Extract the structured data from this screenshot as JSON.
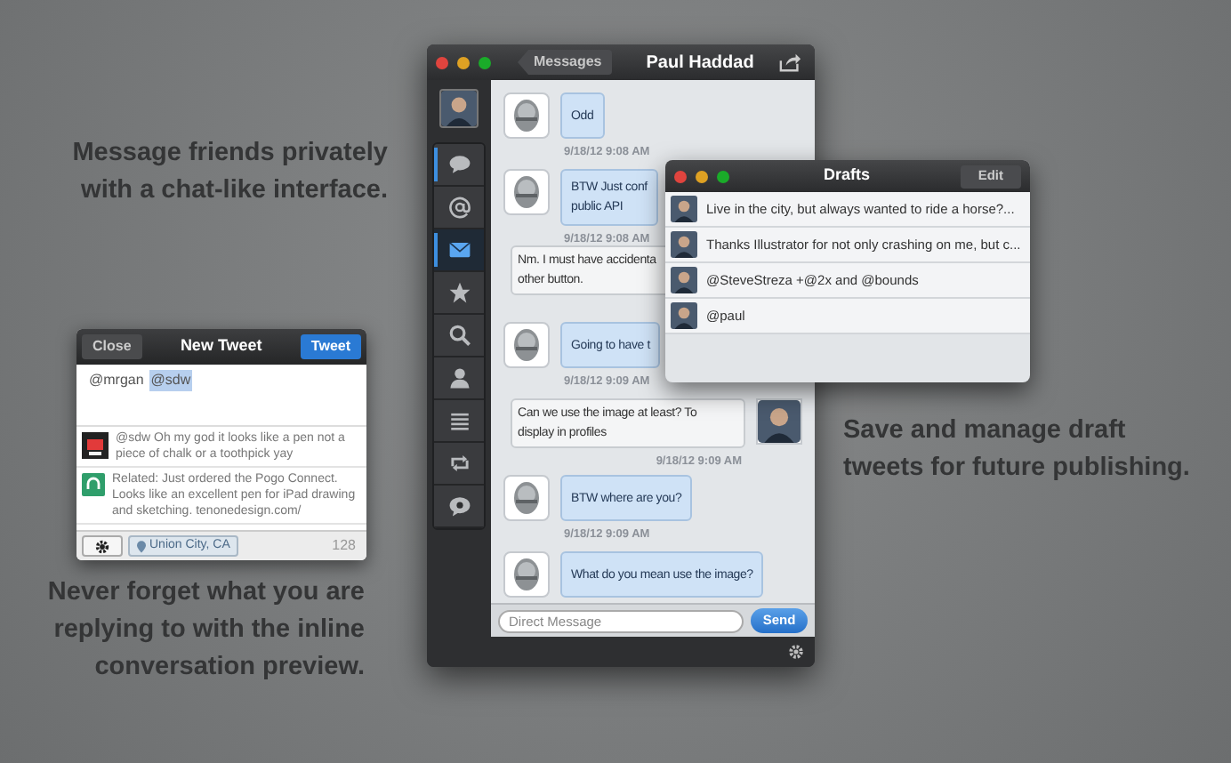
{
  "captions": [
    {
      "kind": "right",
      "lines": [
        "Message friends privately",
        "with a chat-like interface."
      ]
    },
    {
      "kind": "right",
      "lines": [
        "Never forget what you are",
        "replying to with the inline",
        "conversation preview."
      ]
    },
    {
      "kind": "left",
      "lines": [
        "Save and manage draft",
        "tweets for future publishing."
      ]
    }
  ],
  "new_tweet": {
    "close": "Close",
    "title": "New Tweet",
    "tweet": "Tweet",
    "mentions": [
      {
        "text": "@mrgan",
        "selected": false
      },
      {
        "text": "@sdw",
        "selected": true
      }
    ],
    "previews": [
      {
        "kind": "avatar",
        "lines": [
          "@sdw Oh my god it looks like a pen not a",
          "piece of chalk or a toothpick yay"
        ]
      },
      {
        "kind": "logo",
        "lines": [
          "Related: Just ordered the Pogo Connect.",
          "Looks like an excellent pen for iPad drawing",
          "and sketching. tenonedesign.com/"
        ]
      }
    ],
    "location": "Union City, CA",
    "count": "128"
  },
  "chat_window": {
    "back_button": "Messages",
    "title": "Paul Haddad",
    "sidebar": [
      {
        "kind": "chat",
        "selected": false,
        "unread": true
      },
      {
        "kind": "at",
        "selected": false,
        "unread": false
      },
      {
        "kind": "mail",
        "selected": true,
        "unread": true
      },
      {
        "kind": "star",
        "selected": false,
        "unread": false
      },
      {
        "kind": "search",
        "selected": false,
        "unread": false
      },
      {
        "kind": "person",
        "selected": false,
        "unread": false
      },
      {
        "kind": "list",
        "selected": false,
        "unread": false
      },
      {
        "kind": "retweet",
        "selected": false,
        "unread": false
      },
      {
        "kind": "eye",
        "selected": false,
        "unread": false
      }
    ],
    "messages": [
      {
        "kind": "incoming",
        "lines": [
          "Odd"
        ],
        "time": "9/18/12 9:08 AM"
      },
      {
        "kind": "incoming",
        "lines": [
          "BTW Just conf",
          "public API"
        ],
        "time": "9/18/12 9:08 AM"
      },
      {
        "kind": "outgoing",
        "lines": [
          "Nm. I must have accidenta",
          "other button."
        ]
      },
      {
        "kind": "incoming",
        "lines": [
          "Going to have t"
        ],
        "time": "9/18/12 9:09 AM"
      },
      {
        "kind": "outgoing",
        "lines": [
          "Can we use the image at least? To",
          "display in profiles"
        ],
        "time": "9/18/12 9:09 AM",
        "avatar": true
      },
      {
        "kind": "incoming",
        "lines": [
          "BTW where are you?"
        ],
        "time": "9/18/12 9:09 AM"
      },
      {
        "kind": "incoming",
        "lines": [
          "What do you mean use the image?"
        ]
      }
    ],
    "composer": {
      "placeholder": "Direct Message",
      "send": "Send"
    }
  },
  "drafts_window": {
    "title": "Drafts",
    "edit": "Edit",
    "items": [
      "Live in the city, but always wanted to ride a horse?...",
      "Thanks Illustrator for not only crashing on me, but c...",
      "@SteveStreza +@2x and @bounds",
      "@paul"
    ]
  }
}
